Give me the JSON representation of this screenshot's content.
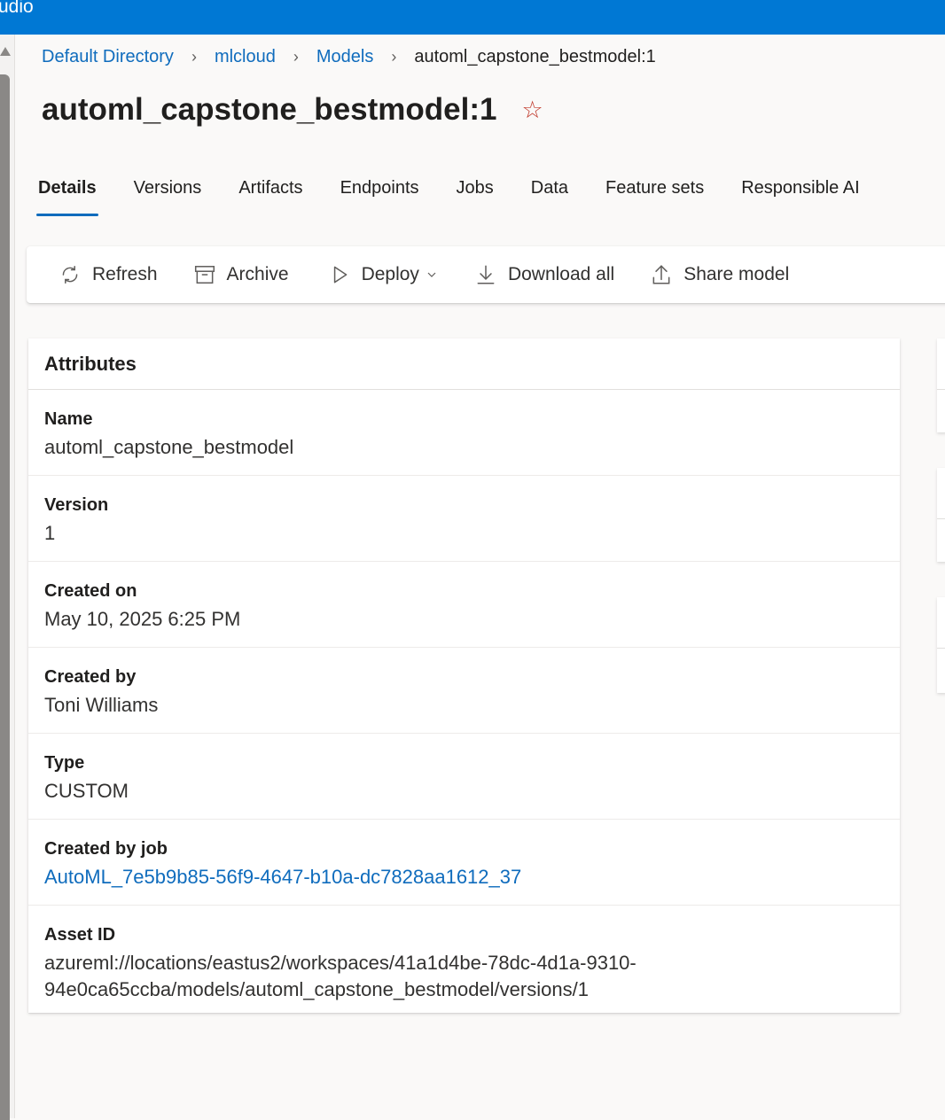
{
  "app": {
    "title": "udio"
  },
  "breadcrumb": {
    "items": [
      "Default Directory",
      "mlcloud",
      "Models"
    ],
    "current": "automl_capstone_bestmodel:1"
  },
  "page": {
    "title": "automl_capstone_bestmodel:1",
    "favorite_icon": "star-outline-icon"
  },
  "tabs": [
    {
      "label": "Details",
      "active": true
    },
    {
      "label": "Versions"
    },
    {
      "label": "Artifacts"
    },
    {
      "label": "Endpoints"
    },
    {
      "label": "Jobs"
    },
    {
      "label": "Data"
    },
    {
      "label": "Feature sets"
    },
    {
      "label": "Responsible AI"
    }
  ],
  "toolbar": {
    "refresh": "Refresh",
    "archive": "Archive",
    "deploy": "Deploy",
    "download_all": "Download all",
    "share_model": "Share model"
  },
  "attributes": {
    "header": "Attributes",
    "rows": [
      {
        "label": "Name",
        "value": "automl_capstone_bestmodel"
      },
      {
        "label": "Version",
        "value": "1"
      },
      {
        "label": "Created on",
        "value": "May 10, 2025 6:25 PM"
      },
      {
        "label": "Created by",
        "value": "Toni Williams"
      },
      {
        "label": "Type",
        "value": "CUSTOM"
      },
      {
        "label": "Created by job",
        "value": "AutoML_7e5b9b85-56f9-4647-b10a-dc7828aa1612_37"
      },
      {
        "label": "Asset ID",
        "value_line1": "azureml://locations/eastus2/workspaces/41a1d4be-78dc-4d1a-9310-",
        "value_line2": "94e0ca65ccba/models/automl_capstone_bestmodel/versions/1"
      }
    ]
  },
  "colors": {
    "accent": "#0078d4",
    "link": "#0f6cbd",
    "star": "#c0392b"
  }
}
